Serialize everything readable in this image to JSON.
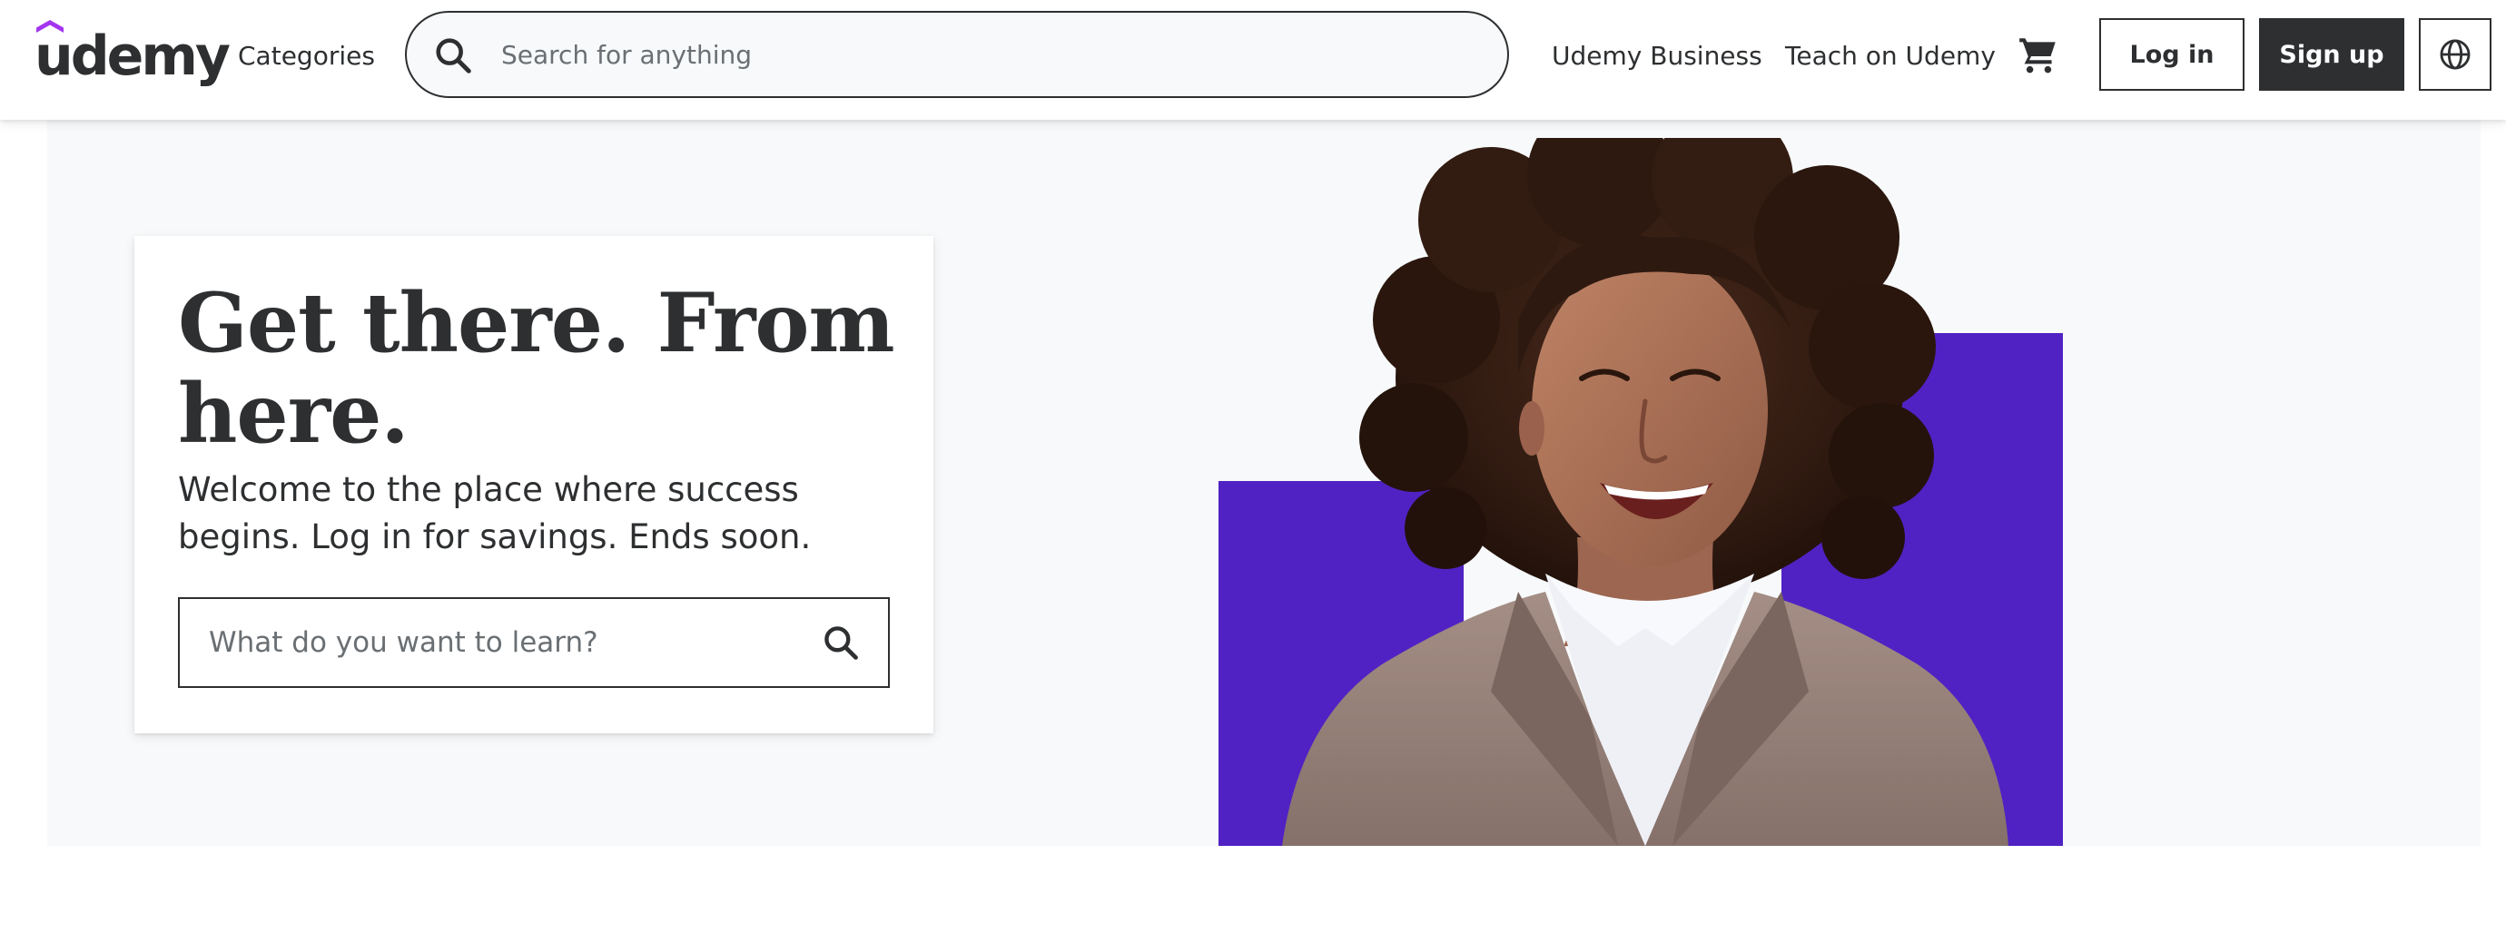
{
  "header": {
    "logo_text": "udemy",
    "categories_label": "Categories",
    "search": {
      "placeholder": "Search for anything"
    },
    "nav_business": "Udemy Business",
    "nav_teach": "Teach on Udemy",
    "login_label": "Log in",
    "signup_label": "Sign up",
    "icons": {
      "search": "search-icon",
      "cart": "cart-icon",
      "language": "globe-icon"
    }
  },
  "hero": {
    "title": "Get there. From here.",
    "subtitle": "Welcome to the place where success begins. Log in for savings. Ends soon.",
    "search": {
      "placeholder": "What do you want to learn?",
      "icon": "search-icon"
    },
    "image": "smiling-woman-with-curly-hair"
  },
  "colors": {
    "brand_purple": "#a435f0",
    "hero_purple": "#5022c3",
    "text_dark": "#2d2f31",
    "hero_background": "#f7f9fa"
  }
}
